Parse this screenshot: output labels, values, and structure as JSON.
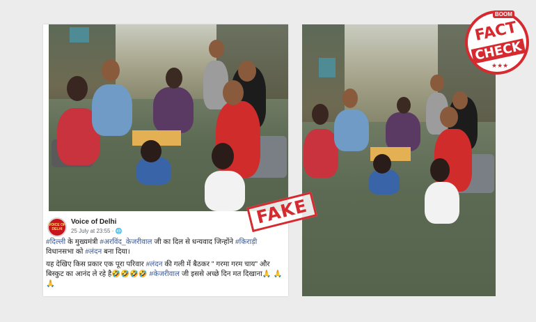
{
  "post": {
    "page_name": "Voice of Delhi",
    "avatar_text": "VOICE OF DELHI",
    "timestamp": "25 July at 23:55",
    "privacy_icon": "globe-icon",
    "line1_a": "#दिल्ली",
    "line1_b": " के मुख्यमंत्री ",
    "line1_c": "#अरविंद_केजरीवाल",
    "line1_d": " जी का दिल से धन्यवाद जिन्होंने ",
    "line1_e": "#किराड़ी",
    "line1_f": " विधानसभा को ",
    "line1_g": "#लंदन",
    "line1_h": " बना दिया।",
    "line2_a": "यह देखिए किस प्रकार एक पूरा परिवार ",
    "line2_b": "#लंदन",
    "line2_c": " की गली में बैठकर \" गरमा गरम चाय\" और बिस्कुट का आनंद ले रहे है🤣🤣🤣🤣 ",
    "line2_d": "#केजरीवाल",
    "line2_e": " जी इससे अच्छे दिन मत दिखाना🙏 🙏🙏"
  },
  "stamp": {
    "fake_label": "FAKE"
  },
  "badge": {
    "boom": "BOOM",
    "fact": "FACT",
    "check": "CHECK",
    "stars": "★★★"
  },
  "colors": {
    "stamp_red": "#d52a2f",
    "hashtag_blue": "#385898"
  }
}
